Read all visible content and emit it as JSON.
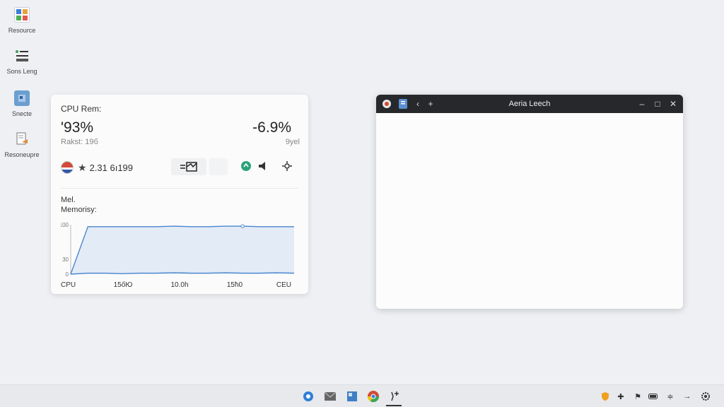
{
  "desktop": {
    "icons": [
      {
        "label": "Resource",
        "icon": "resource-icon"
      },
      {
        "label": "Sons Leng",
        "icon": "list-icon"
      },
      {
        "label": "Snecte",
        "icon": "window-icon"
      },
      {
        "label": "Resoneupre",
        "icon": "document-edit-icon"
      }
    ]
  },
  "widget": {
    "title": "CPU Rem:",
    "metric_left": "'93%",
    "metric_right": "-6.9%",
    "sub_left": "Rakst: 19б",
    "sub_right": "9yel",
    "stat_value": "2.31 6ı199",
    "memory_label_1": "Mel.",
    "memory_label_2": "Memorisy:",
    "accent_color": "#4a86d0"
  },
  "chart_data": {
    "type": "area",
    "ylabels": [
      "100",
      "30",
      "0"
    ],
    "xlabels": [
      "CPU",
      "15őЮ",
      "10.0h",
      "15ħ0",
      "CEU"
    ],
    "series": [
      {
        "values": [
          0,
          96,
          96,
          96,
          96,
          96,
          97,
          96,
          96,
          97,
          97,
          96,
          96,
          96
        ]
      },
      {
        "values": [
          0,
          2,
          2,
          1,
          2,
          2,
          3,
          2,
          2,
          3,
          2,
          2,
          3,
          2
        ]
      }
    ],
    "ylim": [
      0,
      100
    ],
    "grid": false,
    "colors": {
      "line": "#4a86d0",
      "fill": "#e3ebf6"
    }
  },
  "window": {
    "title": "Aeria Leech",
    "controls": {
      "back": "‹",
      "new_tab": "+",
      "minimize": "–",
      "maximize": "□",
      "close": "✕"
    },
    "titlebar_color": "#26282b"
  },
  "taskbar": {
    "pinned": [
      {
        "icon": "gear-badge-icon",
        "color": "#2f7fd8"
      },
      {
        "icon": "mail-icon",
        "color": "#555"
      },
      {
        "icon": "calendar-icon",
        "color": "#3f7fc4"
      },
      {
        "icon": "chrome-icon",
        "color": "#d24a35"
      },
      {
        "icon": "sparkle-icon",
        "color": "#333"
      }
    ],
    "tray": [
      "shield-icon",
      "plus-icon",
      "flag-icon",
      "battery-icon",
      "wifi-icon",
      "arrow-icon",
      "settings-icon"
    ]
  }
}
